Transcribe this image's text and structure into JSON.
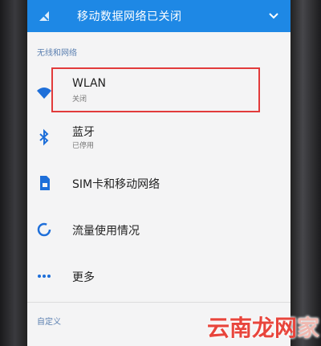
{
  "banner": {
    "title": "移动数据网络已关闭"
  },
  "sections": {
    "wireless": "无线和网络",
    "custom": "自定义"
  },
  "items": [
    {
      "label": "WLAN",
      "sub": "关闭",
      "icon": "wifi-icon"
    },
    {
      "label": "蓝牙",
      "sub": "已停用",
      "icon": "bluetooth-icon"
    },
    {
      "label": "SIM卡和移动网络",
      "icon": "sim-card-icon"
    },
    {
      "label": "流量使用情况",
      "icon": "data-usage-icon"
    },
    {
      "label": "更多",
      "icon": "more-dots-icon"
    }
  ],
  "colors": {
    "banner": "#1e88e5",
    "accent": "#1e6fd9",
    "highlight": "#e23b3b"
  },
  "watermark": {
    "text": "云南龙网",
    "suffix": "家"
  }
}
